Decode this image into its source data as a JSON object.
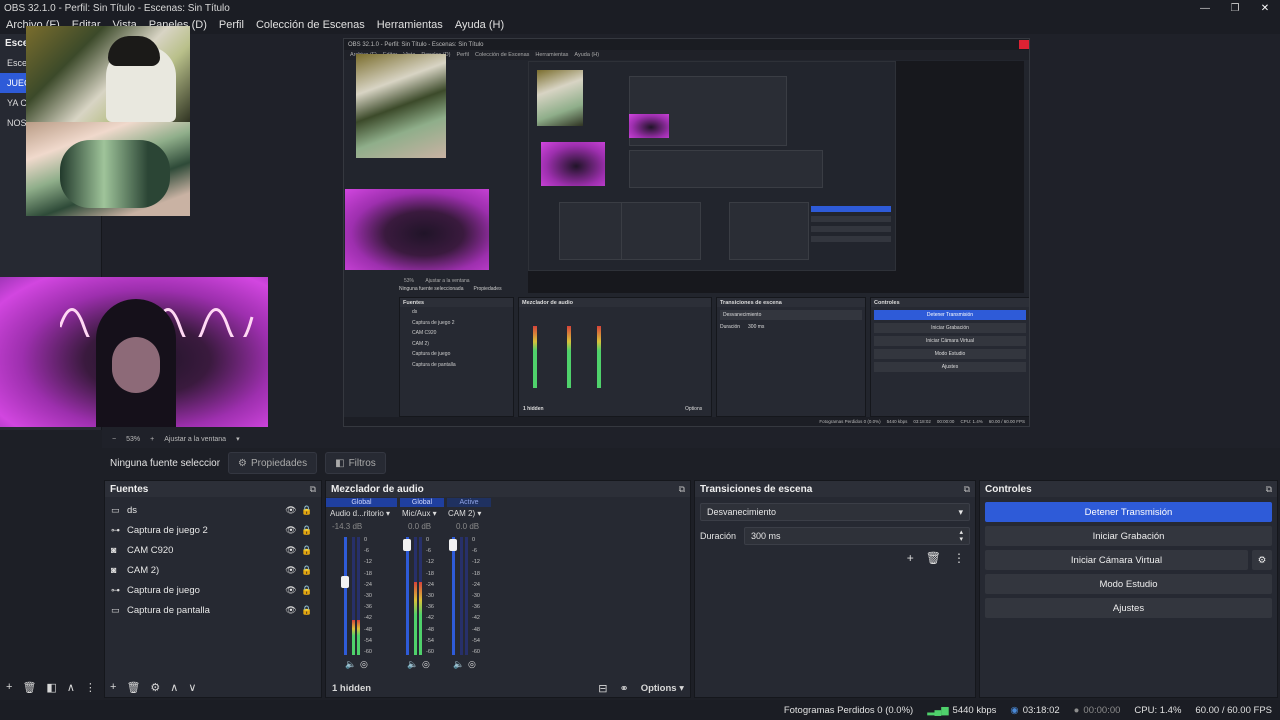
{
  "window": {
    "title": "OBS 32.1.0 - Perfil: Sin Título - Escenas: Sin Título",
    "buttons": {
      "minimize": "—",
      "restore": "❐",
      "close": "✕"
    }
  },
  "menu": [
    "Archivo (F)",
    "Editar",
    "Vista",
    "Paneles (D)",
    "Perfil",
    "Colección de Escenas",
    "Herramientas",
    "Ayuda (H)"
  ],
  "scenes": {
    "title": "Esce",
    "items": [
      {
        "label": "Esce",
        "selected": false
      },
      {
        "label": "JUEG",
        "selected": true
      },
      {
        "label": "YA C",
        "selected": false
      },
      {
        "label": "NOS",
        "selected": false
      }
    ]
  },
  "nested_preview": {
    "title": "OBS 32.1.0 - Perfil: Sin Título - Escenas: Sin Título",
    "menu": [
      "Archivo (F)",
      "Editar",
      "Vista",
      "Paneles (D)",
      "Perfil",
      "Colección de Escenas",
      "Herramientas",
      "Ayuda (H)"
    ],
    "zoom": [
      "53%",
      "Ajustar a la ventana"
    ],
    "context_label": "Ninguna fuente seleccionada",
    "properties_label": "Propiedades",
    "sources_title": "Fuentes",
    "sources": [
      "ds",
      "Captura de juego 2",
      "CAM C920",
      "CAM 2)",
      "Captura de juego",
      "Captura de pantalla"
    ],
    "mixer_title": "Mezclador de audio",
    "mixer_hidden": "1 hidden",
    "mixer_options": "Options",
    "transitions_title": "Transiciones de escena",
    "transition": "Desvanecimiento",
    "duration_label": "Duración",
    "duration_value": "300 ms",
    "controls_title": "Controles",
    "controls": [
      "Detener Transmisión",
      "Iniciar Grabación",
      "Iniciar Cámara Virtual",
      "Modo Estudio",
      "Ajustes"
    ],
    "status": [
      "Fotogramas Perdidos 0 (0.0%)",
      "5440 kbps",
      "03:18:02",
      "00:00:00",
      "CPU: 1.4%",
      "60.00 / 60.00 FPS"
    ]
  },
  "zoom_bar": {
    "minus": "−",
    "zoom": "53%",
    "plus": "+",
    "fit": "Ajustar a la ventana",
    "arrow": "▾"
  },
  "context": {
    "label": "Ninguna fuente seleccionada",
    "properties": "Propiedades",
    "filters": "Filtros"
  },
  "sources": {
    "title": "Fuentes",
    "float_icon": "⧉",
    "items": [
      {
        "name": "ds",
        "icon": "window-capture-icon",
        "glyph": "▭"
      },
      {
        "name": "Captura de juego 2",
        "icon": "gamepad-icon",
        "glyph": "⊶"
      },
      {
        "name": "CAM C920",
        "icon": "camera-icon",
        "glyph": "◙"
      },
      {
        "name": "CAM 2)",
        "icon": "camera-icon",
        "glyph": "◙"
      },
      {
        "name": "Captura de juego",
        "icon": "gamepad-icon",
        "glyph": "⊶"
      },
      {
        "name": "Captura de pantalla",
        "icon": "monitor-icon",
        "glyph": "▭"
      }
    ],
    "toolbar": {
      "add": "+",
      "remove": "🗑",
      "filters": "◧",
      "up": "∧",
      "more": "⋮"
    }
  },
  "mixer": {
    "title": "Mezclador de audio",
    "channels": [
      {
        "tag": "Global",
        "tag_active": false,
        "name": "Audio d...ritorio",
        "db": "-14.3 dB",
        "fader": 0.63,
        "level": 0.3
      },
      {
        "tag": "Global",
        "tag_active": false,
        "name": "Mic/Aux",
        "db": "0.0 dB",
        "fader": 0.98,
        "level": 0.62
      },
      {
        "tag": "Active",
        "tag_active": true,
        "name": "CAM 2)",
        "db": "0.0 dB",
        "fader": 0.98,
        "level": 0.0
      }
    ],
    "scale": [
      "0",
      "-6",
      "-12",
      "-18",
      "-24",
      "-30",
      "-36",
      "-42",
      "-48",
      "-54",
      "-60"
    ],
    "hidden": "1 hidden",
    "options": "Options",
    "toolbar": {
      "add": "+",
      "remove": "🗑",
      "settings": "⚙",
      "up": "∧",
      "down": "∨"
    }
  },
  "transitions": {
    "title": "Transiciones de escena",
    "selected": "Desvanecimiento",
    "duration_label": "Duración",
    "duration_value": "300 ms",
    "toolbar": {
      "add": "+",
      "remove": "🗑",
      "more": "⋮"
    }
  },
  "controls": {
    "title": "Controles",
    "stop_stream": "Detener Transmisión",
    "start_recording": "Iniciar Grabación",
    "start_virtual_cam": "Iniciar Cámara Virtual",
    "studio_mode": "Modo Estudio",
    "settings": "Ajustes"
  },
  "status": {
    "dropped_frames": "Fotogramas Perdidos 0 (0.0%)",
    "bitrate": "5440 kbps",
    "stream_time": "03:18:02",
    "record_time": "00:00:00",
    "cpu": "CPU: 1.4%",
    "fps": "60.00 / 60.00 FPS"
  },
  "colors": {
    "accent": "#2e5bd8",
    "background": "#1d1f26",
    "panel": "#262932",
    "meter_green": "#4fd16b",
    "meter_yellow": "#d8c13a",
    "meter_red": "#d6433a",
    "meter_idle": "#3b4fb8"
  }
}
